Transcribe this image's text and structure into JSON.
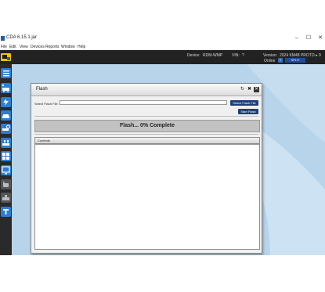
{
  "window": {
    "title": "CDA 6.15.1.jar",
    "minimize": "–",
    "maximize": "☐",
    "close": "✕"
  },
  "menu": [
    "File",
    "Edit",
    "View",
    "Devices",
    "Reports",
    "Window",
    "Help"
  ],
  "header": {
    "device_label": "Device:",
    "device_value": "RDM-WMP",
    "vin_label": "VIN:",
    "vin_value": "?",
    "version_label": "Version:",
    "version_value": "2024 KM48 PROTO ▸ 9",
    "online_label": "Online",
    "help": "?",
    "split_button": "SPLIT"
  },
  "sidebar": {
    "items": [
      {
        "icon": "list-icon",
        "active": true
      },
      {
        "icon": "car-network-icon",
        "active": true
      },
      {
        "icon": "lightning-icon",
        "active": true
      },
      {
        "icon": "car-icon",
        "active": true
      },
      {
        "icon": "car-search-icon",
        "active": true
      },
      {
        "icon": "car-tools-icon",
        "active": true
      },
      {
        "icon": "grid-tools-icon",
        "active": true
      },
      {
        "icon": "monitor-icon",
        "active": true
      },
      {
        "icon": "hand-icon",
        "active": false
      },
      {
        "icon": "car-wrench-icon",
        "active": false
      },
      {
        "icon": "text-tool-icon",
        "active": true
      }
    ]
  },
  "dialog": {
    "title": "Flash",
    "select_label": "Select Flash File:",
    "file_value": "",
    "select_button": "Select Flash File",
    "start_button": "Start Flash",
    "progress_text": "Flash... 0% Complete",
    "progress_fraction": 0,
    "contents_header": "Contents"
  },
  "colors": {
    "header_bg": "#222222",
    "accent": "#2a7fd4",
    "button": "#1e3f7a",
    "background": "#b8d4ea"
  }
}
